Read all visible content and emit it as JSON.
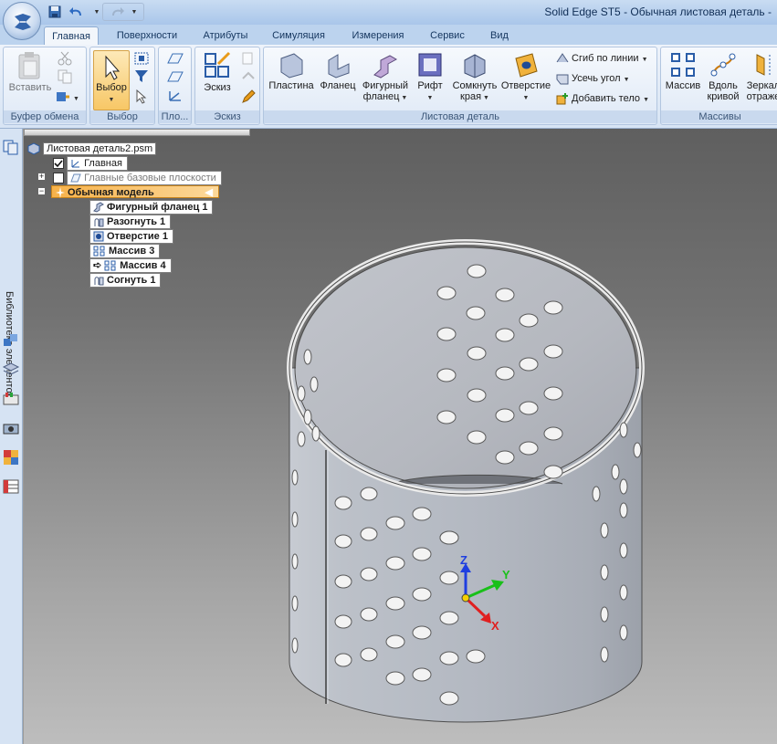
{
  "window": {
    "title": "Solid Edge ST5 - Обычная листовая деталь -"
  },
  "tabs": [
    "Главная",
    "Поверхности",
    "Атрибуты",
    "Симуляция",
    "Измерения",
    "Сервис",
    "Вид"
  ],
  "ribbon": {
    "clipboard": {
      "paste": "Вставить",
      "group": "Буфер обмена"
    },
    "select": {
      "select": "Выбор",
      "group": "Выбор"
    },
    "planes": {
      "group": "Пло..."
    },
    "sketch": {
      "sketch": "Эскиз",
      "group": "Эскиз"
    },
    "sheet": {
      "plate": "Пластина",
      "flange": "Фланец",
      "contour1": "Фигурный",
      "contour2": "фланец",
      "rib": "Рифт",
      "close1": "Сомкнуть",
      "close2": "края",
      "hole": "Отверстие",
      "bend_along_line": "Сгиб по линии",
      "cut_corner": "Усечь угол",
      "add_body": "Добавить тело",
      "group": "Листовая деталь"
    },
    "patterns": {
      "pattern": "Массив",
      "along1": "Вдоль",
      "along2": "кривой",
      "mirror1": "Зеркал",
      "mirror2": "отраже",
      "group": "Массивы"
    }
  },
  "sidebar": {
    "library_label": "Библиотека элементов"
  },
  "tree": {
    "file": "Листовая деталь2.psm",
    "main": "Главная",
    "base_planes": "Главные базовые плоскости",
    "model": "Обычная модель",
    "features": [
      "Фигурный фланец 1",
      "Разогнуть 1",
      "Отверстие 1",
      "Массив 3",
      "Массив 4",
      "Согнуть 1"
    ]
  },
  "triad": {
    "x": "X",
    "y": "Y",
    "z": "Z"
  },
  "colors": {
    "model_highlight": "#f5a623",
    "axis_x": "#e02020",
    "axis_y": "#19c019",
    "axis_z": "#1f3fe0"
  }
}
